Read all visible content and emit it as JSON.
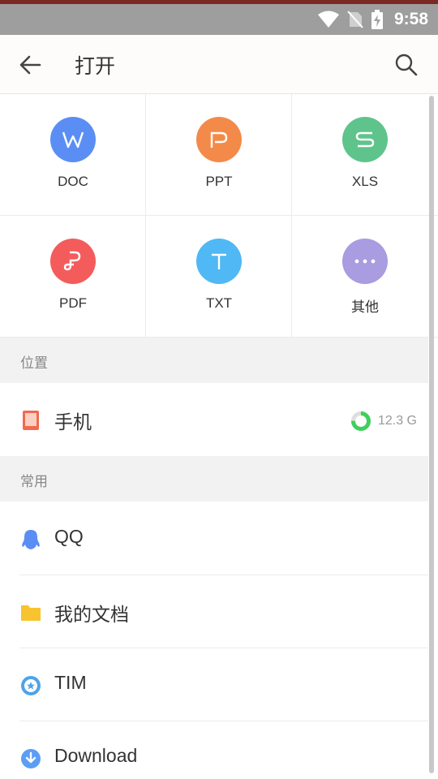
{
  "status_bar": {
    "time": "9:58"
  },
  "app_bar": {
    "title": "打开"
  },
  "file_types": [
    {
      "label": "DOC",
      "letter": "W",
      "color": "#5b8ef5"
    },
    {
      "label": "PPT",
      "letter": "P",
      "color": "#f48a49"
    },
    {
      "label": "XLS",
      "letter": "S",
      "color": "#5fc48c"
    },
    {
      "label": "PDF",
      "letter": "P",
      "color": "#f45c5c"
    },
    {
      "label": "TXT",
      "letter": "T",
      "color": "#4fb8f5"
    },
    {
      "label": "其他",
      "letter": "···",
      "color": "#a99ce0"
    }
  ],
  "location_section": {
    "title": "位置"
  },
  "phone": {
    "label": "手机",
    "storage": "12.3 G",
    "storage_used_fraction": 0.75
  },
  "common_section": {
    "title": "常用"
  },
  "common_items": [
    {
      "label": "QQ",
      "icon": "qq-icon",
      "color": "#5b8ef5"
    },
    {
      "label": "我的文档",
      "icon": "folder-icon",
      "color": "#f7c42e"
    },
    {
      "label": "TIM",
      "icon": "tim-icon",
      "color": "#4fa3e8"
    },
    {
      "label": "Download",
      "icon": "download-icon",
      "color": "#5b9ef5"
    }
  ]
}
